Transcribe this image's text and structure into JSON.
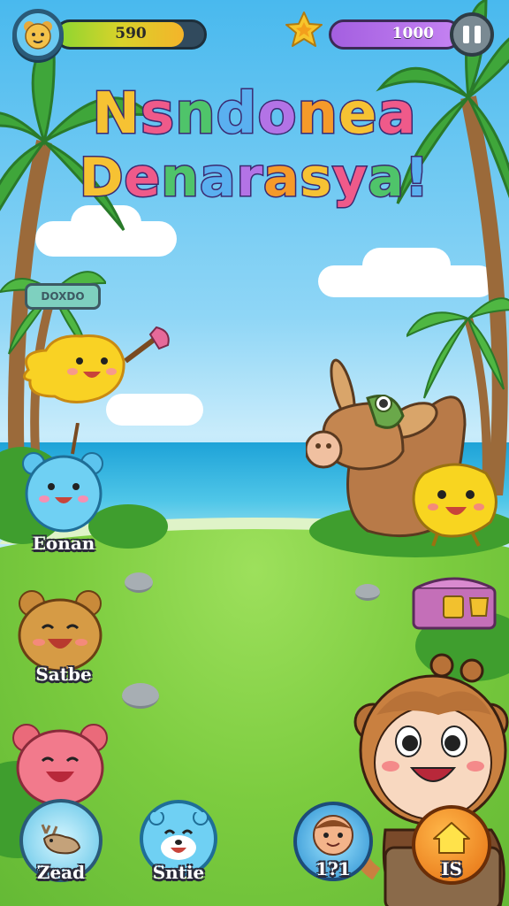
{
  "hud": {
    "avatar_icon": "bear-avatar-icon",
    "xp_value": "590",
    "xp_fill": 0.86,
    "star_icon": "star-icon",
    "gems_value": "1000",
    "pause_icon": "pause-icon"
  },
  "title": {
    "line1": "Nsndonea",
    "line2": "Denarasya!"
  },
  "sign": {
    "text": "DOXDO"
  },
  "characters": {
    "blue_bear": {
      "name": "Eonan"
    },
    "brown_bear": {
      "name": "Satbe"
    },
    "pink_bear": {
      "name": ""
    }
  },
  "bottom_buttons": {
    "left": {
      "label": "Zead",
      "icon": "moose-icon"
    },
    "blue": {
      "label": "Sntie",
      "icon": "blue-bear-icon"
    },
    "mid": {
      "label": "1?1",
      "icon": "boy-face-icon"
    },
    "right": {
      "label": "IS",
      "icon": "home-icon"
    }
  },
  "colors": {
    "sky": "#49b9ee",
    "grass": "#7ccc3f",
    "title_stroke": "#3b2a70",
    "xp_fill": "#d9d22a",
    "gem_bar": "#a45fe0"
  }
}
